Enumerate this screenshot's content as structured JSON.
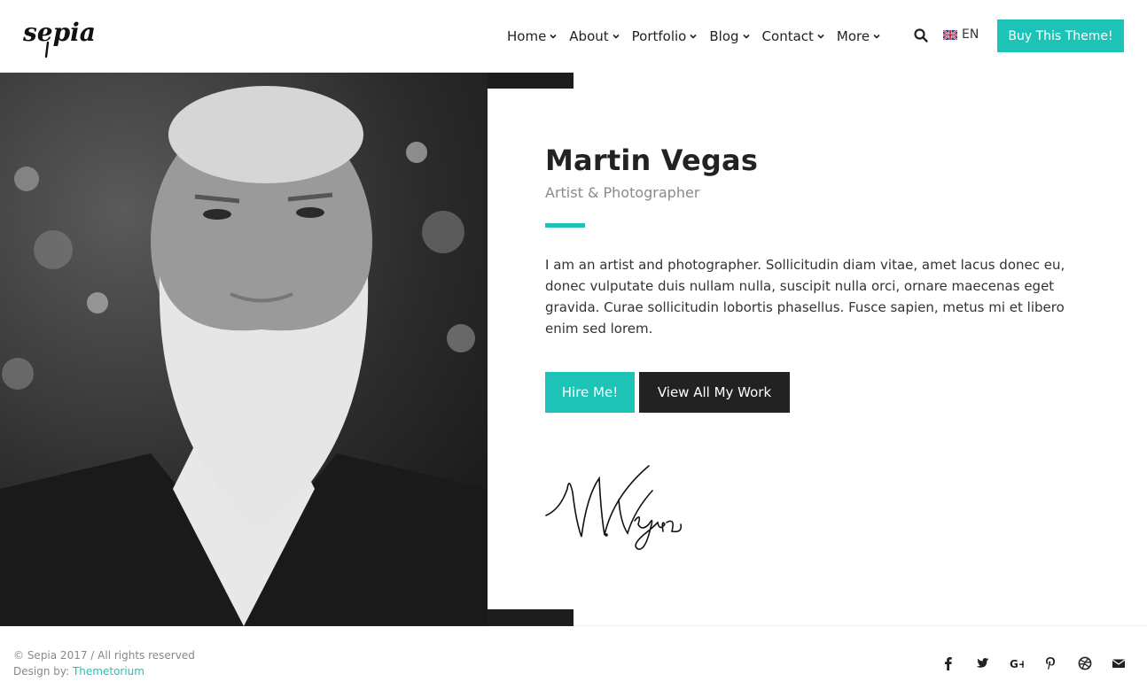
{
  "header": {
    "logo_text": "sepia",
    "nav": [
      {
        "label": "Home"
      },
      {
        "label": "About"
      },
      {
        "label": "Portfolio"
      },
      {
        "label": "Blog"
      },
      {
        "label": "Contact"
      },
      {
        "label": "More"
      }
    ],
    "lang": "EN",
    "buy_label": "Buy This Theme!"
  },
  "profile": {
    "name": "Martin Vegas",
    "role": "Artist & Photographer",
    "bio": "I am an artist and photographer. Sollicitudin diam vitae, amet lacus donec eu, donec vulputate duis nullam nulla, suscipit nulla orci, ornare maecenas eget gravida. Curae sollicitudin lobortis phasellus. Fusce sapien, metus mi et libero enim sed lorem.",
    "hire_label": "Hire Me!",
    "work_label": "View All My Work",
    "signature": "M. Vegas"
  },
  "footer": {
    "copyright": "© Sepia 2017 / All rights reserved",
    "design_prefix": "Design by: ",
    "design_link": "Themetorium",
    "social": [
      "facebook-icon",
      "twitter-icon",
      "google-plus-icon",
      "pinterest-icon",
      "dribbble-icon",
      "envelope-icon"
    ]
  },
  "colors": {
    "accent": "#1ec3b7",
    "dark": "#222222"
  }
}
